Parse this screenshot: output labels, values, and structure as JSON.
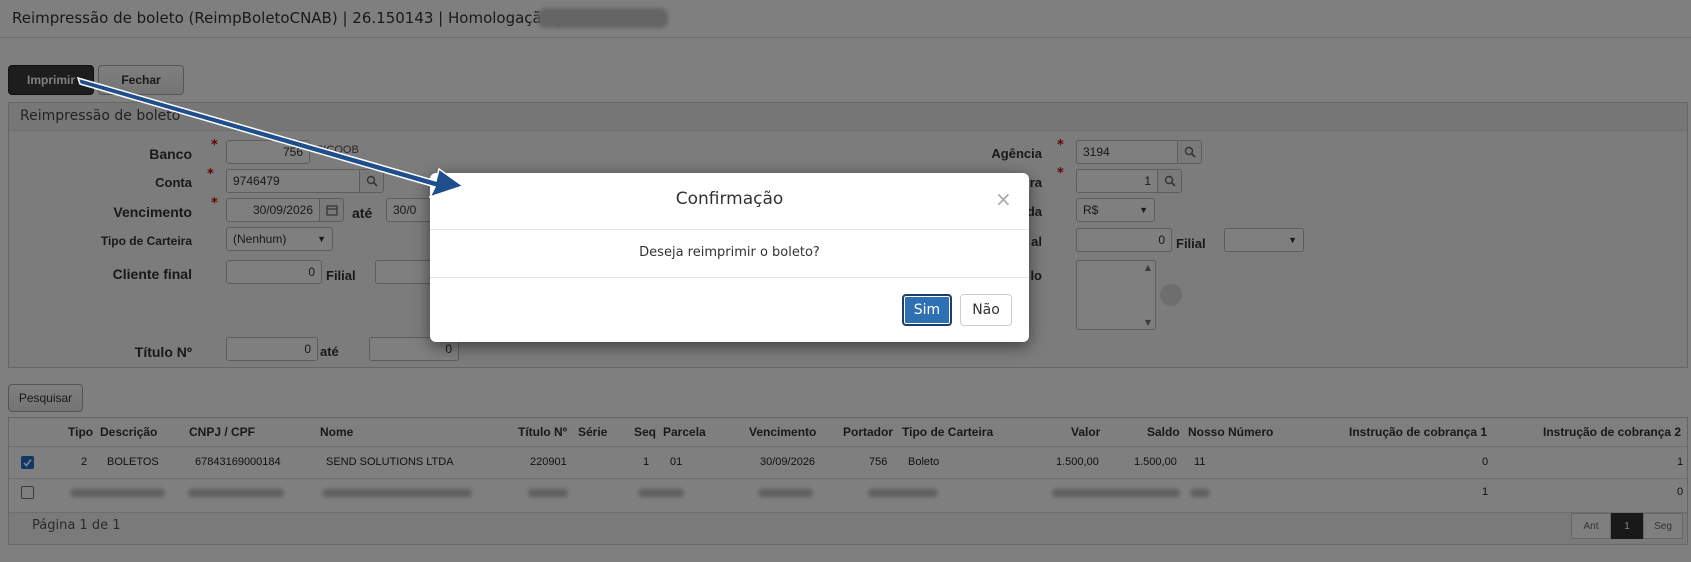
{
  "window": {
    "title": "Reimpressão de boleto (ReimpBoletoCNAB) | 26.150143 | Homologação | "
  },
  "toolbar": {
    "print_label": "Imprimir",
    "close_label": "Fechar"
  },
  "panel": {
    "title": "Reimpressão de boleto",
    "banco": {
      "label": "Banco",
      "value": "756",
      "name": "SICOOB"
    },
    "agencia": {
      "label": "Agência",
      "value": "3194"
    },
    "conta": {
      "label": "Conta",
      "value": "9746479"
    },
    "carteira": {
      "label": "ra",
      "value": "1"
    },
    "vencimento": {
      "label": "Vencimento",
      "from": "30/09/2026",
      "ate_label": "até",
      "to": "30/0"
    },
    "moeda": {
      "label": "da",
      "value": "R$"
    },
    "tipo_carteira": {
      "label": "Tipo de Carteira",
      "value": "(Nenhum)"
    },
    "cliente_inicial": {
      "label": "al",
      "value": "0",
      "filial_label": "Filial"
    },
    "cliente_final": {
      "label": "Cliente final",
      "value": "0",
      "filial_label": "Filial"
    },
    "situacao": {
      "label": "lo"
    },
    "titulo": {
      "label": "Título Nº",
      "from": "0",
      "ate_label": "até",
      "to": "0"
    }
  },
  "search": {
    "label": "Pesquisar"
  },
  "table": {
    "columns": [
      "Tipo",
      "Descrição",
      "CNPJ / CPF",
      "Nome",
      "Título Nº",
      "Série",
      "Seq",
      "Parcela",
      "Vencimento",
      "Portador",
      "Tipo de Carteira",
      "Valor",
      "Saldo",
      "Nosso Número",
      "Instrução de cobrança 1",
      "Instrução de cobrança 2"
    ],
    "rows": [
      {
        "checked": true,
        "tipo": "2",
        "descricao": "BOLETOS",
        "cnpj": "67843169000184",
        "nome": "SEND SOLUTIONS LTDA",
        "titulo": "220901",
        "serie": "",
        "seq": "1",
        "parcela": "01",
        "vencimento": "30/09/2026",
        "portador": "756",
        "tipo_carteira": "Boleto",
        "valor": "1.500,00",
        "saldo": "1.500,00",
        "nosso_numero": "11",
        "instr1": "0",
        "instr2": "1"
      },
      {
        "checked": false,
        "instr1": "1",
        "instr2": "0"
      }
    ]
  },
  "pagination": {
    "text": "Página 1 de 1",
    "prev": "Ant",
    "current": "1",
    "next": "Seg"
  },
  "dialog": {
    "title": "Confirmação",
    "close": "×",
    "message": "Deseja reimprimir o boleto?",
    "confirm_label": "Sim",
    "cancel_label": "Não"
  },
  "icons": {
    "lookup": "search-icon",
    "date": "calendar-icon",
    "close": "close-icon",
    "annotation": "arrow-annotation"
  },
  "colors": {
    "primary_button": "#2f6fb3",
    "arrow": "#1f4e8c",
    "required": "#cc0000"
  }
}
